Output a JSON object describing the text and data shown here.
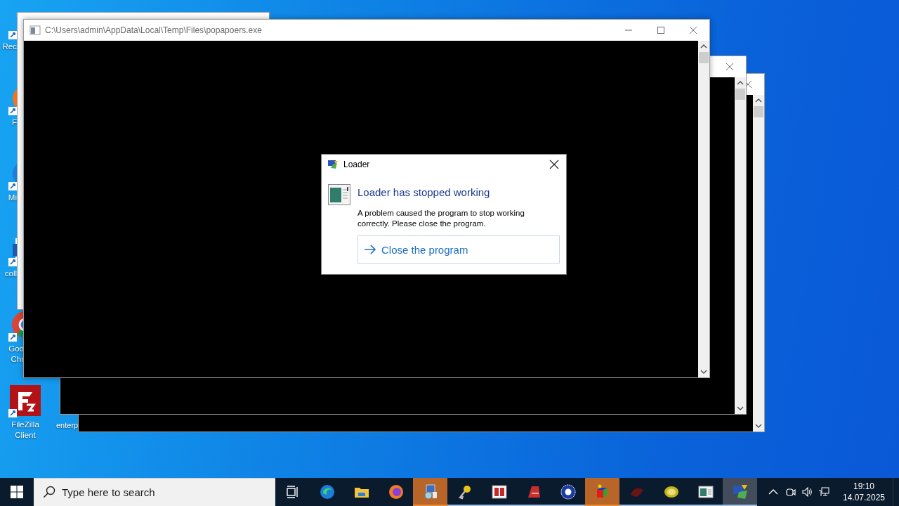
{
  "desktop_icons": [
    {
      "label_lines": [
        "Rec"
      ]
    },
    {
      "label_lines": [
        "F"
      ]
    },
    {
      "label_lines": [
        "Mi"
      ]
    },
    {
      "label_lines": [
        "coll"
      ]
    },
    {
      "label_lines": [
        "Goo",
        "Chr"
      ]
    },
    {
      "label_lines": [
        "FileZilla",
        "Client"
      ]
    },
    {
      "label_lines": [
        "enterp"
      ]
    }
  ],
  "console_window": {
    "title": "C:\\Users\\admin\\AppData\\Local\\Temp\\Files\\popapoers.exe"
  },
  "dialog": {
    "title": "Loader",
    "heading": "Loader has stopped working",
    "message": "A problem caused the program to stop working correctly. Please close the program.",
    "action": "Close the program"
  },
  "taskbar": {
    "search_placeholder": "Type here to search",
    "apps": [
      {
        "running": false,
        "flashing": false,
        "selected": false
      },
      {
        "running": false,
        "flashing": false,
        "selected": false
      },
      {
        "running": false,
        "flashing": false,
        "selected": false
      },
      {
        "running": true,
        "flashing": true,
        "selected": false
      },
      {
        "running": true,
        "flashing": false,
        "selected": false
      },
      {
        "running": true,
        "flashing": false,
        "selected": false
      },
      {
        "running": true,
        "flashing": false,
        "selected": false
      },
      {
        "running": true,
        "flashing": false,
        "selected": false
      },
      {
        "running": true,
        "flashing": true,
        "selected": false
      },
      {
        "running": true,
        "flashing": false,
        "selected": false
      },
      {
        "running": true,
        "flashing": false,
        "selected": false
      },
      {
        "running": true,
        "flashing": false,
        "selected": false
      },
      {
        "running": true,
        "flashing": false,
        "selected": true
      }
    ],
    "time": "19:10",
    "date": "14.07.2025"
  }
}
